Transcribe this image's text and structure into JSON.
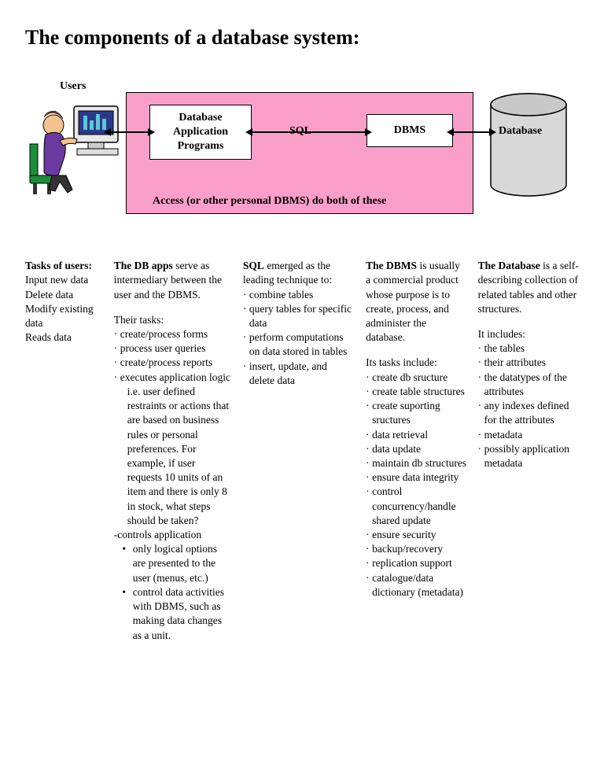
{
  "title": "The components of a database system:",
  "diagram": {
    "users_label": "Users",
    "app_box": "Database Application Programs",
    "sql_label": "SQL",
    "dbms_box": "DBMS",
    "db_label": "Database",
    "access_label": "Access (or other personal DBMS) do both of these"
  },
  "col1": {
    "heading": "Tasks of users:",
    "lines": [
      "Input new data",
      "Delete data",
      "Modify existing data",
      "Reads data"
    ]
  },
  "col2": {
    "intro_bold": "The DB apps",
    "intro_rest": " serve as intermediary between the user and the DBMS.",
    "tasks_heading": "Their tasks:",
    "t1": "create/process forms",
    "t2": "process user queries",
    "t3": "create/process reports",
    "t4a": "executes application logic",
    "t4b": "i.e. user defined restraints or actions that are based on business rules or personal preferences.  For example, if user requests 10 units of an item and there is only 8 in stock, what steps should be taken?",
    "controls": "-controls application",
    "b1": "only logical options are presented to the user (menus, etc.)",
    "b2": "control data activities with DBMS, such as making data changes as a unit."
  },
  "col3": {
    "intro_bold": "SQL",
    "intro_rest": " emerged as the leading technique to:",
    "t1": "combine tables",
    "t2": "query tables for specific data",
    "t3": "perform computations on data stored in tables",
    "t4": "insert, update, and delete data"
  },
  "col4": {
    "intro_bold": "The DBMS",
    "intro_rest": " is usually a commercial product whose purpose is to create, process, and administer the database.",
    "tasks_heading": "Its tasks include:",
    "items": [
      "create db sructure",
      "create table structures",
      "create suporting sructures",
      "data retrieval",
      "data update",
      "maintain db structures",
      "ensure data integrity",
      "control concurrency/handle shared update",
      "ensure security",
      "backup/recovery",
      "replication support",
      "catalogue/data dictionary (metadata)"
    ]
  },
  "col5": {
    "intro_bold": "The Database",
    "intro_rest": " is a self-describing collection of related tables and other structures.",
    "inc_heading": "It includes:",
    "items": [
      "the tables",
      "their attributes",
      "the datatypes of the attributes",
      "any indexes defined for the attributes",
      "metadata",
      "possibly application metadata"
    ]
  }
}
